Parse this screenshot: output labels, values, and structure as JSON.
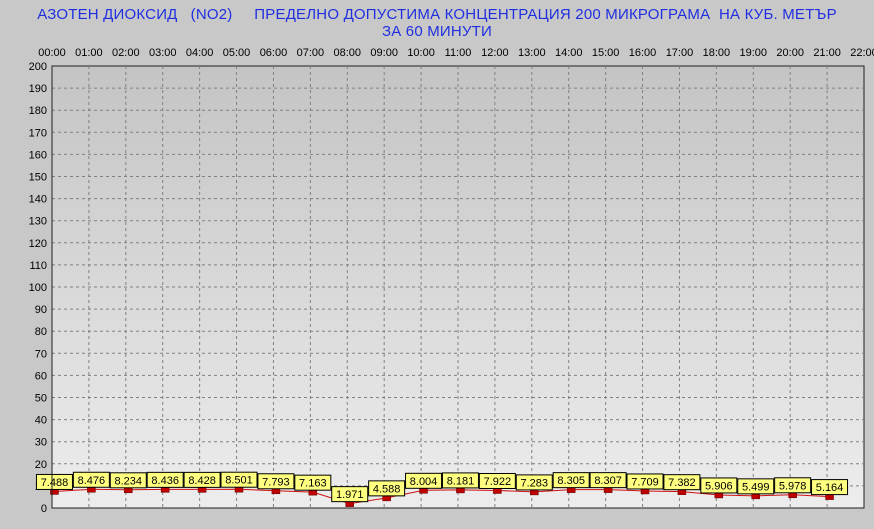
{
  "chart_data": {
    "type": "line",
    "title_line_1": "АЗОТЕН ДИОКСИД   (NO2)     ПРЕДЕЛНО ДОПУСТИМА КОНЦЕНТРАЦИЯ 200 МИКРОГРАМА  НА КУБ. МЕТЪР",
    "title_line_2": "ЗА 60 МИНУТИ",
    "x_ticks": [
      "00:00",
      "01:00",
      "02:00",
      "03:00",
      "04:00",
      "05:00",
      "06:00",
      "07:00",
      "08:00",
      "09:00",
      "10:00",
      "11:00",
      "12:00",
      "13:00",
      "14:00",
      "15:00",
      "16:00",
      "17:00",
      "18:00",
      "19:00",
      "20:00",
      "21:00",
      "22:00"
    ],
    "y_ticks": [
      0,
      10,
      20,
      30,
      40,
      50,
      60,
      70,
      80,
      90,
      100,
      110,
      120,
      130,
      140,
      150,
      160,
      170,
      180,
      190,
      200
    ],
    "ylim": [
      0,
      200
    ],
    "grid": true,
    "series": [
      {
        "x": [
          "00:00",
          "01:00",
          "02:00",
          "03:00",
          "04:00",
          "05:00",
          "06:00",
          "07:00",
          "08:00",
          "09:00",
          "10:00",
          "11:00",
          "12:00",
          "13:00",
          "14:00",
          "15:00",
          "16:00",
          "17:00",
          "18:00",
          "19:00",
          "20:00",
          "21:00"
        ],
        "values": [
          7.488,
          8.476,
          8.234,
          8.436,
          8.428,
          8.501,
          7.793,
          7.163,
          1.971,
          4.588,
          8.004,
          8.181,
          7.922,
          7.283,
          8.305,
          8.307,
          7.709,
          7.382,
          5.906,
          5.499,
          5.978,
          5.164
        ],
        "labels": [
          "7.488",
          "8.476",
          "8.234",
          "8.436",
          "8.428",
          "8.501",
          "7.793",
          "7.163",
          "1.971",
          "4.588",
          "8.004",
          "8.181",
          "7.922",
          "7.283",
          "8.305",
          "8.307",
          "7.709",
          "7.382",
          "5.906",
          "5.499",
          "5.978",
          "5.164"
        ]
      }
    ],
    "colors": {
      "title": "#1f2fe0",
      "line": "#d01010",
      "marker": "#c00000",
      "label_fill": "#ffff80",
      "plot_bg_top": "#c4c4c4",
      "plot_bg_bottom": "#ececec",
      "grid": "#808080",
      "background": "#c8c8c8"
    }
  }
}
